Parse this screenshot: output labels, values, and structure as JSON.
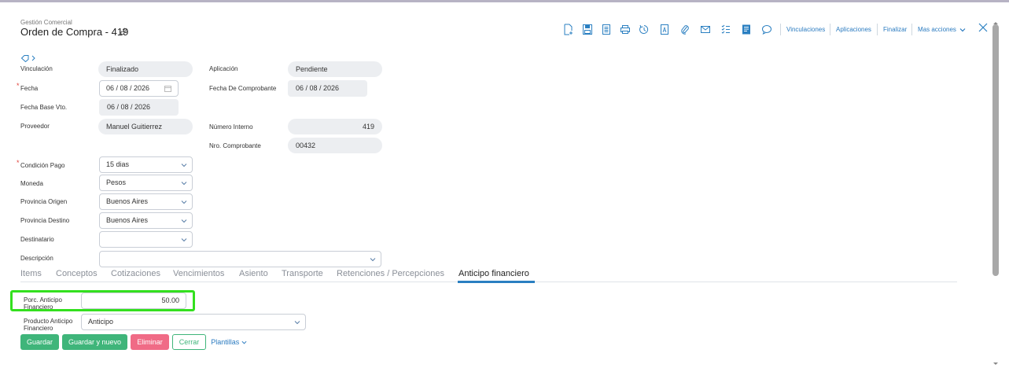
{
  "header": {
    "module": "Gestión Comercial",
    "title": "Orden de Compra - 419"
  },
  "toolbar": {
    "icons": [
      "new-document-icon",
      "save-icon",
      "document-list-icon",
      "print-icon",
      "history-icon",
      "pdf-icon",
      "attachment-icon",
      "email-icon",
      "checklist-icon",
      "notes-icon",
      "comment-icon"
    ],
    "links": {
      "vinculaciones": "Vinculaciones",
      "aplicaciones": "Aplicaciones",
      "finalizar": "Finalizar",
      "mas_acciones": "Mas acciones"
    }
  },
  "form": {
    "vinculacion": {
      "label": "Vinculación",
      "value": "Finalizado"
    },
    "aplicacion": {
      "label": "Aplicación",
      "value": "Pendiente"
    },
    "fecha": {
      "label": "Fecha",
      "value": "06 / 08 / 2026",
      "required": true
    },
    "fecha_comprobante": {
      "label": "Fecha De Comprobante",
      "value": "06 / 08 / 2026"
    },
    "fecha_base_vto": {
      "label": "Fecha Base Vto.",
      "value": "06 / 08 / 2026"
    },
    "proveedor": {
      "label": "Proveedor",
      "value": "Manuel Guitierrez"
    },
    "numero_interno": {
      "label": "Número Interno",
      "value": "419"
    },
    "nro_comprobante": {
      "label": "Nro. Comprobante",
      "value": "00432"
    },
    "condicion_pago": {
      "label": "Condición Pago",
      "value": "15 dias",
      "required": true
    },
    "moneda": {
      "label": "Moneda",
      "value": "Pesos"
    },
    "provincia_origen": {
      "label": "Provincia Origen",
      "value": "Buenos Aires"
    },
    "provincia_destino": {
      "label": "Provincia Destino",
      "value": "Buenos Aires"
    },
    "destinatario": {
      "label": "Destinatario",
      "value": ""
    },
    "descripcion": {
      "label": "Descripción",
      "value": ""
    }
  },
  "tabs": [
    {
      "label": "Items",
      "active": false
    },
    {
      "label": "Conceptos",
      "active": false
    },
    {
      "label": "Cotizaciones",
      "active": false
    },
    {
      "label": "Vencimientos",
      "active": false
    },
    {
      "label": "Asiento",
      "active": false
    },
    {
      "label": "Transporte",
      "active": false
    },
    {
      "label": "Retenciones / Percepciones",
      "active": false
    },
    {
      "label": "Anticipo financiero",
      "active": true
    }
  ],
  "anticipo": {
    "porc_label_1": "Porc. Anticipo",
    "porc_label_2": "Financiero",
    "porc_value": "50.00",
    "producto_label_1": "Producto Anticipo",
    "producto_label_2": "Financiero",
    "producto_value": "Anticipo"
  },
  "buttons": {
    "guardar": "Guardar",
    "guardar_nuevo": "Guardar y nuevo",
    "eliminar": "Eliminar",
    "cerrar": "Cerrar",
    "plantillas": "Plantillas"
  },
  "colors": {
    "accent": "#2a7fc1",
    "green": "#3fb57a",
    "red": "#f06b86",
    "highlight": "#33e01e"
  }
}
